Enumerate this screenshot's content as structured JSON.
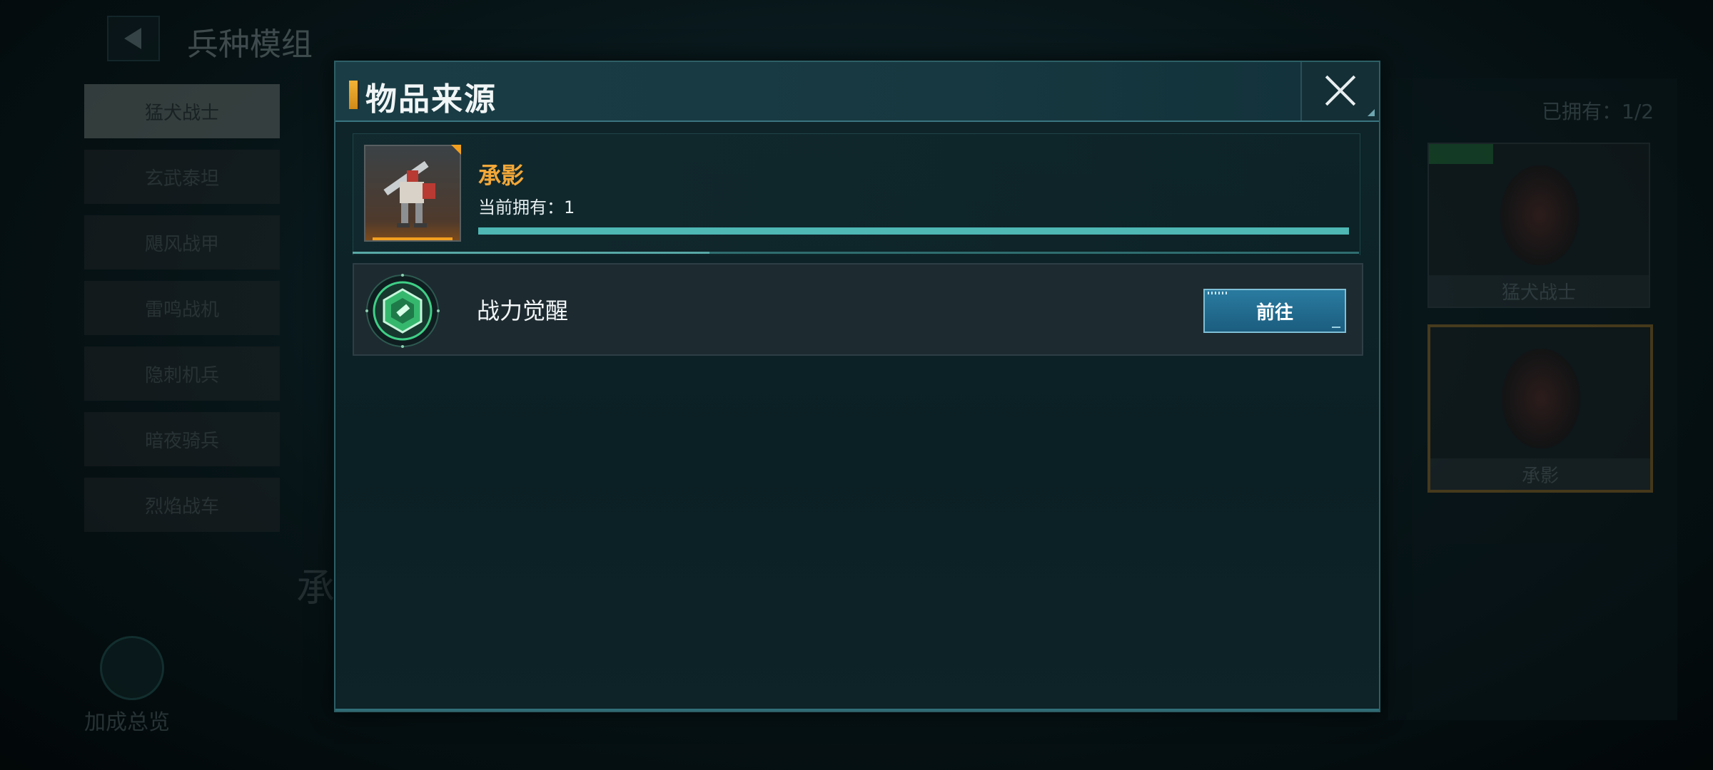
{
  "background": {
    "page_title": "兵种模组",
    "sidebar_items": [
      "猛犬战士",
      "玄武泰坦",
      "飓风战甲",
      "雷鸣战机",
      "隐刺机兵",
      "暗夜骑兵",
      "烈焰战车"
    ],
    "hero_name": "承影",
    "bottom_label": "加成总览",
    "owned_count": "已拥有：1/2",
    "cards": [
      "猛犬战士",
      "承影"
    ]
  },
  "modal": {
    "title": "物品来源",
    "close_icon": "close-icon",
    "item": {
      "name": "承影",
      "owned_text": "当前拥有：1",
      "name_color": "#f4a838"
    },
    "sources": [
      {
        "label": "战力觉醒",
        "button_label": "前往",
        "icon": "awaken-emblem-icon"
      }
    ]
  }
}
